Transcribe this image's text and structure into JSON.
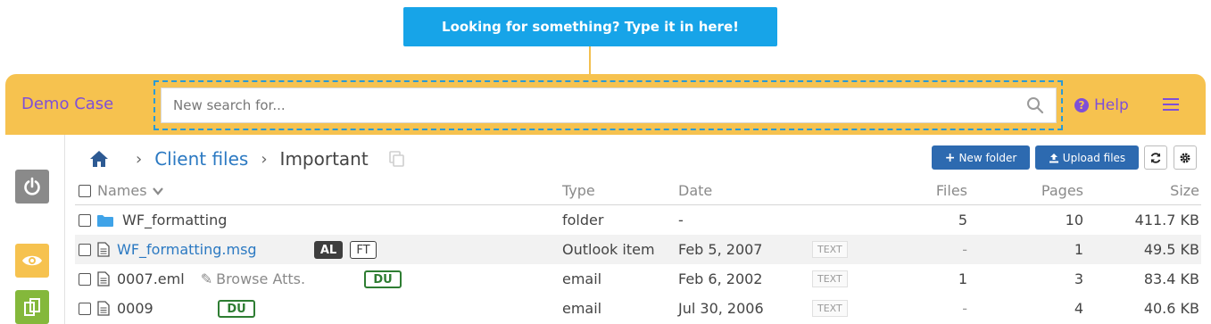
{
  "tooltip": {
    "text": "Looking for something? Type it in here!"
  },
  "topbar": {
    "case_title": "Demo Case",
    "search_placeholder": "New search for...",
    "help_label": "Help",
    "colors": {
      "bar": "#f6c24f",
      "accent": "#7e4fd8",
      "link": "#2b79c2",
      "primary_button": "#2d6ab0"
    }
  },
  "sidebar": {
    "buttons": [
      "power-icon",
      "eye-icon",
      "copy-icon"
    ]
  },
  "breadcrumb": {
    "items": [
      "Client files",
      "Important"
    ]
  },
  "toolbar": {
    "new_folder_label": "New folder",
    "upload_label": "Upload files"
  },
  "table": {
    "headers": {
      "names": "Names",
      "type": "Type",
      "date": "Date",
      "files": "Files",
      "pages": "Pages",
      "size": "Size"
    },
    "rows": [
      {
        "name": "WF_formatting",
        "type": "folder",
        "date": "-",
        "text_badge": "",
        "files": "5",
        "pages": "10",
        "size": "411.7 KB"
      },
      {
        "name": "WF_formatting.msg",
        "type": "Outlook item",
        "date": "Feb 5, 2007",
        "tags": [
          "AL",
          "FT"
        ],
        "text_badge": "TEXT",
        "files": "-",
        "pages": "1",
        "size": "49.5 KB"
      },
      {
        "name": "0007.eml",
        "browse_label": "Browse Atts.",
        "type": "email",
        "date": "Feb 6, 2002",
        "tags": [
          "DU"
        ],
        "text_badge": "TEXT",
        "files": "1",
        "pages": "3",
        "size": "83.4 KB"
      },
      {
        "name": "0009",
        "type": "email",
        "date": "Jul 30, 2006",
        "tags": [
          "DU"
        ],
        "text_badge": "TEXT",
        "files": "-",
        "pages": "4",
        "size": "40.6 KB"
      }
    ]
  }
}
